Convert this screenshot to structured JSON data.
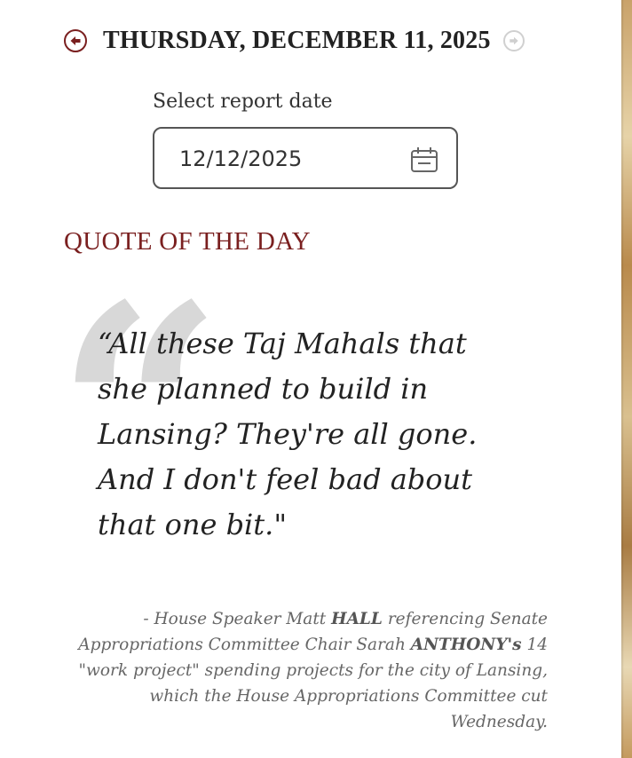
{
  "header": {
    "date_title": "THURSDAY, DECEMBER 11, 2025",
    "prev_icon": "arrow-left-circle-icon",
    "next_icon": "arrow-right-circle-icon"
  },
  "date_picker": {
    "label": "Select report date",
    "value": "12/12/2025",
    "icon": "calendar-icon"
  },
  "section": {
    "heading": "QUOTE OF THE DAY",
    "quote_icon": "quotation-mark-icon"
  },
  "quote": {
    "text": "“All these Taj Mahals that she planned to build in Lansing? They're all gone. And I don't feel bad about that one bit.\"",
    "attribution": {
      "part1": "- House Speaker Matt ",
      "name1": "HALL",
      "part2": " referencing Senate Appropriations Committee Chair Sarah ",
      "name2": "ANTHONY's",
      "part3": " 14 \"work project\" spending projects for the city of Lansing, which the House Appropriations Committee cut Wednesday."
    }
  },
  "colors": {
    "accent": "#7a1f1f",
    "text": "#222222",
    "muted": "#666666",
    "quote_mark": "#d8d8d8"
  }
}
